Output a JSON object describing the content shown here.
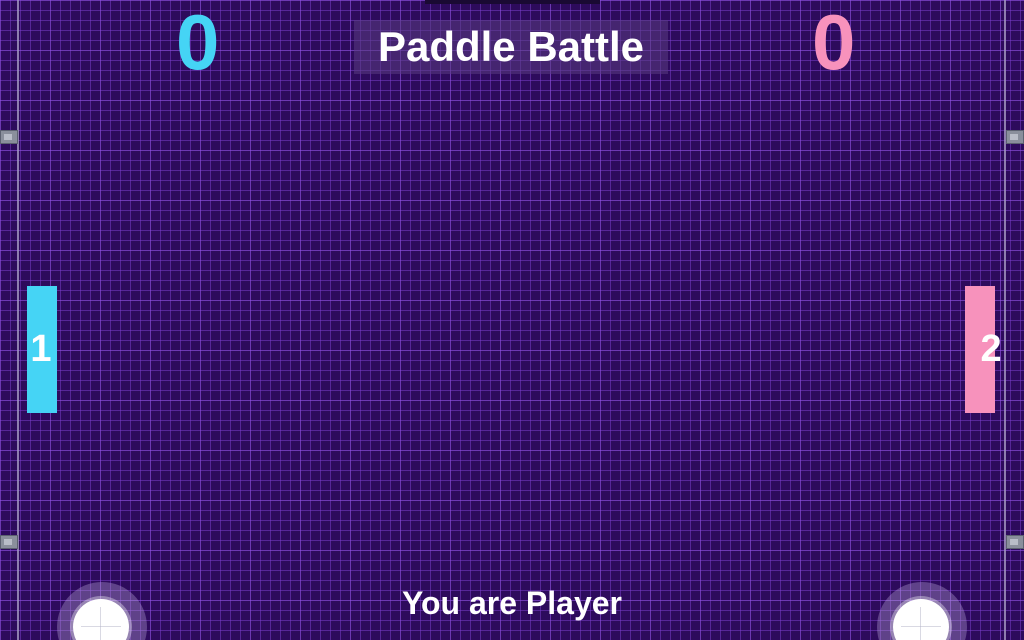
{
  "game": {
    "title": "Paddle Battle",
    "status_text": "You are Player"
  },
  "scores": {
    "player1": "0",
    "player2": "0"
  },
  "paddles": {
    "left_label": "1",
    "right_label": "2"
  },
  "colors": {
    "background": "#2d0b5c",
    "grid_line": "#783cc8",
    "player1": "#45d4f5",
    "player2": "#f792bc",
    "text": "#ffffff"
  },
  "icons": {
    "left_control": "joystick-icon",
    "right_control": "joystick-icon"
  }
}
